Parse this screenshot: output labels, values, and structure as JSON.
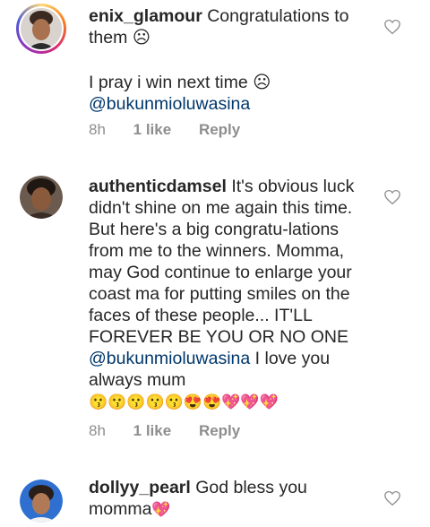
{
  "comments": [
    {
      "username": "enix_glamour",
      "text_1": "Congratulations to them ☹",
      "text_2": "I pray i win next time ☹",
      "mention": "@bukunmioluwasina",
      "time": "8h",
      "likes": "1 like",
      "reply": "Reply"
    },
    {
      "username": "authenticdamsel",
      "text": "It's obvious luck didn't shine on me again this time. But here's a big congratu-lations from me to the winners. Momma, may God continue to enlarge your coast ma for putting smiles on the faces of these people... IT'LL FOREVER BE YOU OR NO ONE",
      "mention": "@bukunmioluwasina",
      "text_after": "I love you always mum",
      "emojis": "😗😗😗😗😗😍😍💖💖💖",
      "time": "8h",
      "likes": "1 like",
      "reply": "Reply"
    },
    {
      "username": "dollyy_pearl",
      "text": "God bless you momma",
      "emoji": "💖"
    }
  ],
  "colors": {
    "text": "#262626",
    "meta": "#8e8e8e",
    "mention": "#00376b"
  },
  "icons": [
    "heart-outline-icon"
  ]
}
